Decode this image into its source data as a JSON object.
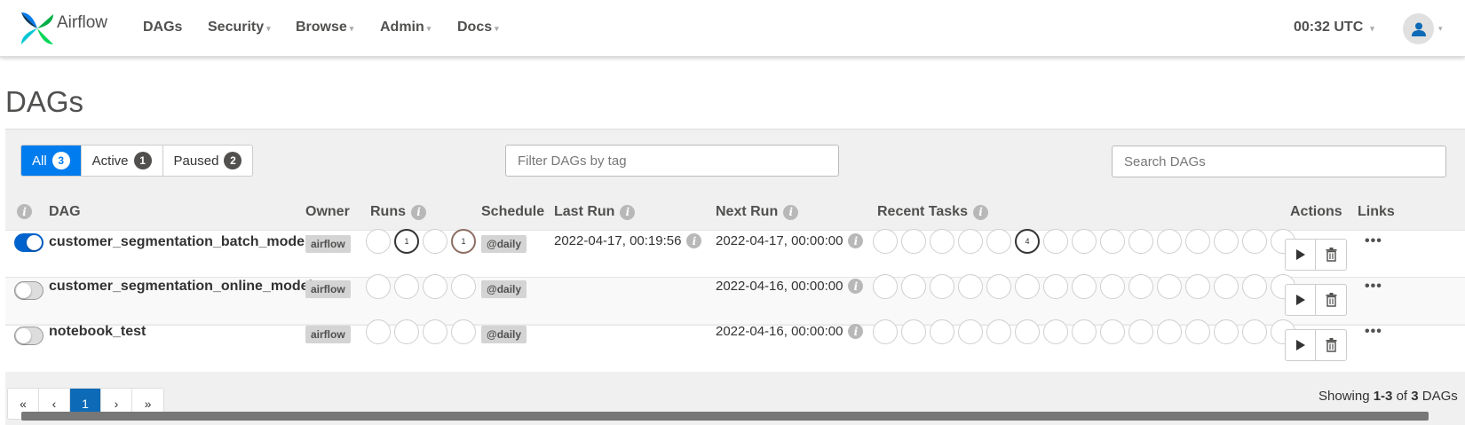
{
  "nav": {
    "brand": "Airflow",
    "items": [
      {
        "label": "DAGs",
        "dropdown": false
      },
      {
        "label": "Security",
        "dropdown": true
      },
      {
        "label": "Browse",
        "dropdown": true
      },
      {
        "label": "Admin",
        "dropdown": true
      },
      {
        "label": "Docs",
        "dropdown": true
      }
    ],
    "time": "00:32 UTC"
  },
  "page_title": "DAGs",
  "filters": {
    "all": {
      "label": "All",
      "count": "3"
    },
    "active": {
      "label": "Active",
      "count": "1"
    },
    "paused": {
      "label": "Paused",
      "count": "2"
    }
  },
  "tag_filter_placeholder": "Filter DAGs by tag",
  "search_placeholder": "Search DAGs",
  "columns": {
    "dag": "DAG",
    "owner": "Owner",
    "runs": "Runs",
    "schedule": "Schedule",
    "last_run": "Last Run",
    "next_run": "Next Run",
    "recent_tasks": "Recent Tasks",
    "actions": "Actions",
    "links": "Links"
  },
  "rows": [
    {
      "enabled": true,
      "name": "customer_segmentation_batch_model",
      "owner": "airflow",
      "runs": [
        "",
        "1",
        "",
        "1"
      ],
      "schedule": "@daily",
      "last_run": "2022-04-17, 00:19:56",
      "next_run": "2022-04-17, 00:00:00",
      "recent_tasks": [
        "",
        "",
        "",
        "",
        "",
        "4",
        "",
        "",
        "",
        "",
        "",
        "",
        "",
        "",
        ""
      ]
    },
    {
      "enabled": false,
      "name": "customer_segmentation_online_model",
      "owner": "airflow",
      "runs": [
        "",
        "",
        "",
        ""
      ],
      "schedule": "@daily",
      "last_run": "",
      "next_run": "2022-04-16, 00:00:00",
      "recent_tasks": [
        "",
        "",
        "",
        "",
        "",
        "",
        "",
        "",
        "",
        "",
        "",
        "",
        "",
        "",
        ""
      ]
    },
    {
      "enabled": false,
      "name": "notebook_test",
      "owner": "airflow",
      "runs": [
        "",
        "",
        "",
        ""
      ],
      "schedule": "@daily",
      "last_run": "",
      "next_run": "2022-04-16, 00:00:00",
      "recent_tasks": [
        "",
        "",
        "",
        "",
        "",
        "",
        "",
        "",
        "",
        "",
        "",
        "",
        "",
        "",
        ""
      ]
    }
  ],
  "pagination": {
    "first": "«",
    "prev": "‹",
    "current": "1",
    "next": "›",
    "last": "»"
  },
  "showing": {
    "prefix": "Showing ",
    "range": "1-3",
    "middle": " of ",
    "total": "3",
    "suffix": " DAGs"
  },
  "colors": {
    "accent": "#017cee",
    "toggle_on": "#0062cc",
    "pager_active": "#0d6ab7"
  }
}
